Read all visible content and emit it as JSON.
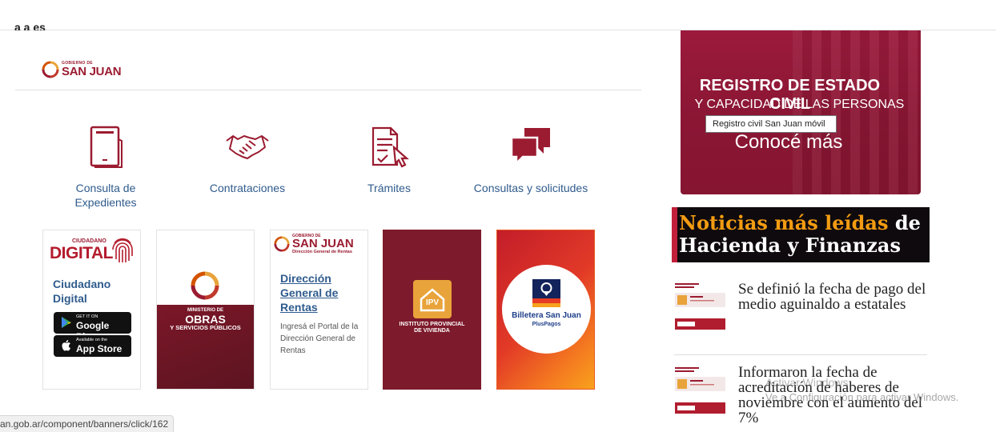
{
  "header": {
    "cut_text": "a a es"
  },
  "logo": {
    "small": "GOBIERNO DE",
    "big": "SAN JUAN"
  },
  "services": [
    {
      "label": "Consulta de Expedientes",
      "icon": "document-icon"
    },
    {
      "label": "Contrataciones",
      "icon": "handshake-icon"
    },
    {
      "label": "Trámites",
      "icon": "form-icon"
    },
    {
      "label": "Consultas y solicitudes",
      "icon": "chat-icon"
    }
  ],
  "cards": {
    "ciudadano": {
      "badge_small": "CIUDADANO",
      "badge_big": "DIGITAL",
      "title": "Ciudadano Digital",
      "google_small": "GET IT ON",
      "google_big": "Google Play",
      "apple_small": "Available on the",
      "apple_big": "App Store"
    },
    "obras": {
      "line1": "MINISTERIO DE",
      "line2": "OBRAS",
      "line3": "Y SERVICIOS PÚBLICOS"
    },
    "rentas": {
      "logo_small": "GOBIERNO DE",
      "logo_big": "SAN JUAN",
      "logo_sub": "Dirección General de Rentas",
      "title": "Dirección General de Rentas",
      "desc": "Ingresá el Portal de la Dirección General de Rentas"
    },
    "ipv": {
      "badge": "IPV",
      "line1": "INSTITUTO PROVINCIAL",
      "line2": "DE VIVIENDA"
    },
    "billetera": {
      "title": "Billetera San Juan",
      "sub": "PlusPagos"
    }
  },
  "banner": {
    "line1": "REGISTRO DE ESTADO CIVIL",
    "line2": "Y CAPACIDAD DE LAS PERSONAS",
    "line3": "Conocé más",
    "tooltip": "Registro civil San Juan móvil"
  },
  "news": {
    "heading_highlight": "Noticias más leídas",
    "heading_rest_1": "de",
    "heading_rest_2": "Hacienda y Finanzas",
    "items": [
      {
        "title": "Se definió la fecha de pago del medio aguinaldo a estatales"
      },
      {
        "title": "Informaron la fecha de acreditación de haberes de noviembre con el aumento del 7%"
      }
    ]
  },
  "overlay": {
    "watermark_1": "Activar Windows",
    "watermark_2": "Ve a Configuración para activar Windows."
  },
  "statusbar": {
    "url": "an.gob.ar/component/banners/click/162"
  },
  "colors": {
    "brand": "#9b1b30",
    "link": "#2f5b8d",
    "accent_orange": "#f39c12"
  }
}
